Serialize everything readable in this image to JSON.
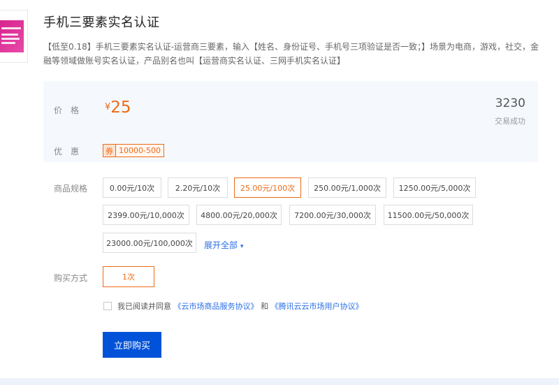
{
  "product": {
    "title": "手机三要素实名认证",
    "description": "【低至0.18】手机三要素实名认证-运营商三要素，输入【姓名、身份证号、手机号三项验证是否一致；】场景为电商，游戏，社交，金融等领域做账号实名认证，产品别名也叫【运营商实名认证、三网手机实名认证】"
  },
  "price": {
    "label": "价格",
    "currency": "¥",
    "value": "25",
    "sales_count": "3230",
    "sales_label": "交易成功"
  },
  "coupon": {
    "label": "优惠",
    "tag": "券",
    "amount": "10000-500"
  },
  "specs": {
    "label": "商品规格",
    "options": [
      "0.00元/10次",
      "2.20元/10次",
      "25.00元/100次",
      "250.00元/1,000次",
      "1250.00元/5,000次",
      "2399.00元/10,000次",
      "4800.00元/20,000次",
      "7200.00元/30,000次",
      "11500.00元/50,000次",
      "23000.00元/100,000次"
    ],
    "selected": "25.00元/100次",
    "expand_label": "展开全部",
    "expand_icon": "▾"
  },
  "buy_method": {
    "label": "购买方式",
    "option": "1次"
  },
  "agreement": {
    "prefix": "我已阅读并同意",
    "link1": "《云市场商品服务协议》",
    "connector": "和",
    "link2": "《腾讯云云市场用户协议》"
  },
  "buy_button": "立即购买",
  "thumbnail": {
    "icon": "product-thumbnail",
    "color": "#d6248e"
  },
  "colors": {
    "accent": "#ee6a16",
    "link": "#2a6ee8",
    "primary_button": "#0052d9",
    "panel_bg": "#f5f9fe"
  }
}
